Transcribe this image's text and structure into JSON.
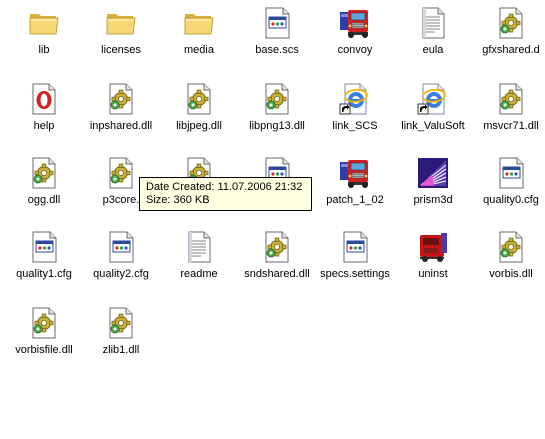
{
  "files": [
    {
      "name": "lib",
      "icon": "folder-icon"
    },
    {
      "name": "licenses",
      "icon": "folder-icon"
    },
    {
      "name": "media",
      "icon": "folder-icon"
    },
    {
      "name": "base.scs",
      "icon": "document-icon"
    },
    {
      "name": "convoy",
      "icon": "truck-icon"
    },
    {
      "name": "eula",
      "icon": "text-document-icon"
    },
    {
      "name": "gfxshared.d",
      "icon": "dll-icon"
    },
    {
      "name": "help",
      "icon": "opera-help-icon"
    },
    {
      "name": "inpshared.dll",
      "icon": "dll-icon"
    },
    {
      "name": "libjpeg.dll",
      "icon": "dll-icon"
    },
    {
      "name": "libpng13.dll",
      "icon": "dll-icon"
    },
    {
      "name": "link_SCS",
      "icon": "ie-shortcut-icon"
    },
    {
      "name": "link_ValuSoft",
      "icon": "ie-shortcut-icon"
    },
    {
      "name": "msvcr71.dll",
      "icon": "dll-icon"
    },
    {
      "name": "ogg.dll",
      "icon": "dll-icon"
    },
    {
      "name": "p3core.",
      "icon": "dll-icon"
    },
    {
      "name": "",
      "icon": "dll-icon"
    },
    {
      "name": "",
      "icon": "document-icon"
    },
    {
      "name": "patch_1_02",
      "icon": "truck-icon"
    },
    {
      "name": "prism3d",
      "icon": "prism-icon"
    },
    {
      "name": "quality0.cfg",
      "icon": "document-icon"
    },
    {
      "name": "quality1.cfg",
      "icon": "document-icon"
    },
    {
      "name": "quality2.cfg",
      "icon": "document-icon"
    },
    {
      "name": "readme",
      "icon": "text-document-icon"
    },
    {
      "name": "sndshared.dll",
      "icon": "dll-icon"
    },
    {
      "name": "specs.settings",
      "icon": "document-icon"
    },
    {
      "name": "uninst",
      "icon": "uninstall-truck-icon"
    },
    {
      "name": "vorbis.dll",
      "icon": "dll-icon"
    },
    {
      "name": "vorbisfile.dll",
      "icon": "dll-icon"
    },
    {
      "name": "zlib1.dll",
      "icon": "dll-icon"
    }
  ],
  "tooltip": {
    "date_created": "Date Created: 11.07.2006 21:32",
    "size": "Size: 360 KB"
  }
}
